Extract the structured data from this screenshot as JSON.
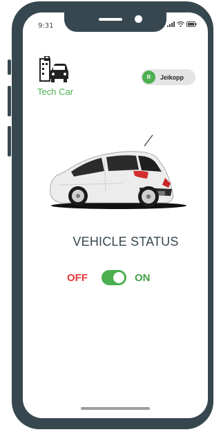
{
  "status_bar": {
    "time": "9:31"
  },
  "brand": {
    "name": "Tech Car"
  },
  "user": {
    "initial": "R",
    "name": "Jeikopp"
  },
  "main": {
    "title": "VEHICLE STATUS"
  },
  "toggle": {
    "off_label": "OFF",
    "on_label": "ON",
    "state": "on"
  },
  "colors": {
    "accent": "#4caf50",
    "off": "#e53935",
    "frame": "#37474f"
  }
}
